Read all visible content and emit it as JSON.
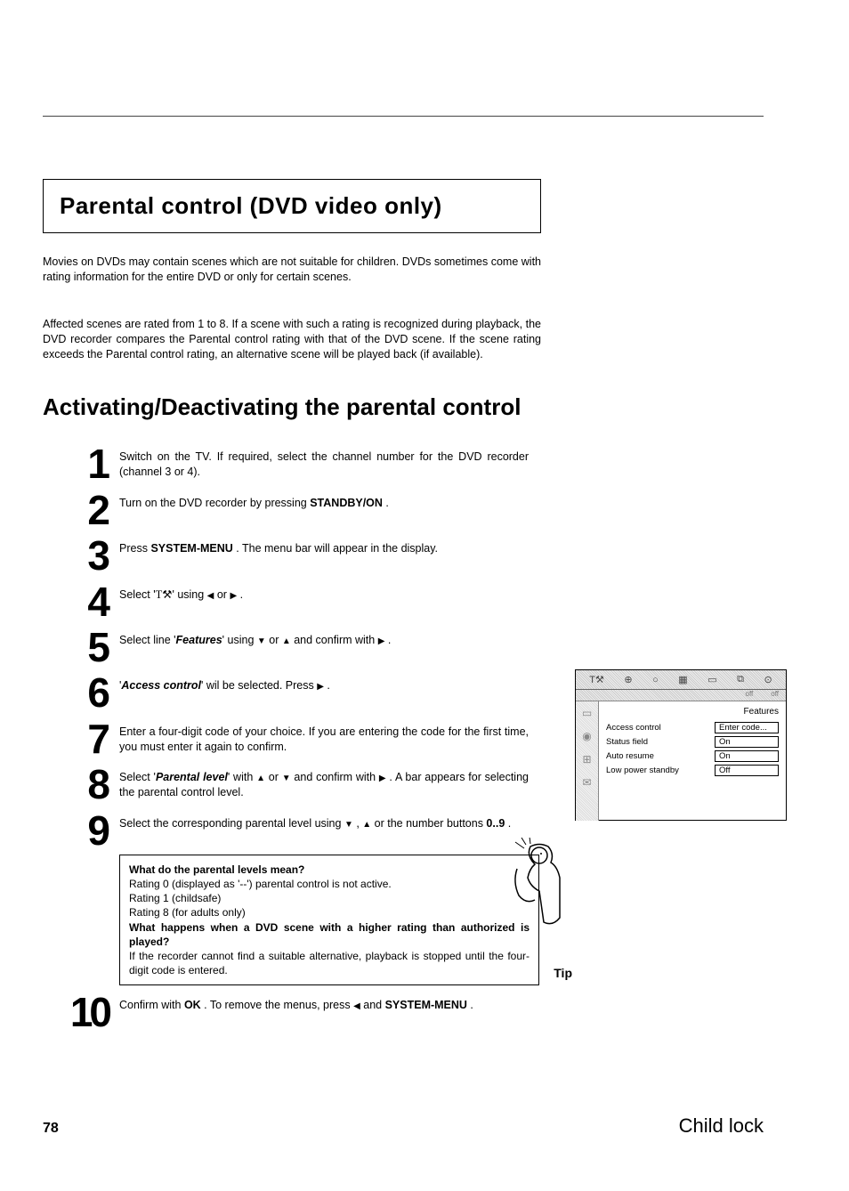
{
  "divider": true,
  "title": "Parental control (DVD video only)",
  "intro_p1": "Movies on DVDs may contain scenes which are not suitable for children. DVDs sometimes come with rating information for the entire DVD or only for certain scenes.",
  "intro_p2": "Affected scenes are rated from 1 to 8. If a scene with such a rating is recognized during playback, the DVD recorder compares the Parental control rating with that of the DVD scene. If the scene rating exceeds the Parental control rating, an alternative scene will be played back (if available).",
  "subheading": "Activating/Deactivating the parental control",
  "steps": {
    "s1": {
      "num": "1",
      "text_a": "Switch on the TV. If required, select the channel number for the DVD recorder (channel 3 or 4)."
    },
    "s2": {
      "num": "2",
      "text_a": "Turn on the DVD recorder by pressing ",
      "btn": "STANDBY/ON",
      "text_b": " ."
    },
    "s3": {
      "num": "3",
      "text_a": "Press ",
      "btn": "SYSTEM-MENU",
      "text_b": " . The menu bar will appear in the display."
    },
    "s4": {
      "num": "4",
      "text_a": "Select '",
      "icon": "wrench",
      "text_b": "' using ",
      "key1": "◀",
      "text_c": " or ",
      "key2": "▶",
      "text_d": " ."
    },
    "s5": {
      "num": "5",
      "text_a": "Select line '",
      "em": "Features",
      "text_b": "' using ",
      "key1": "▼",
      "text_c": " or ",
      "key2": "▲",
      "text_d": " and confirm with ",
      "key3": "▶",
      "text_e": " ."
    },
    "s6": {
      "num": "6",
      "text_a": "'",
      "em": "Access control",
      "text_b": "' wil be selected. Press ",
      "key1": "▶",
      "text_c": " ."
    },
    "s7": {
      "num": "7",
      "text_a": "Enter a four-digit code of your choice. If you are entering the code for the first time, you must enter it again to confirm."
    },
    "s8": {
      "num": "8",
      "text_a": "Select '",
      "em": "Parental level",
      "text_b": "' with ",
      "key1": "▲",
      "text_c": " or ",
      "key2": "▼",
      "text_d": " and confirm with ",
      "key3": "▶",
      "text_e": " . A bar appears for selecting the parental control level."
    },
    "s9": {
      "num": "9",
      "text_a": "Select the corresponding parental level using ",
      "key1": "▼",
      "text_b": " , ",
      "key2": "▲",
      "text_c": " or the number buttons ",
      "btn": "0..9",
      "text_d": " ."
    },
    "s10": {
      "num": "10",
      "text_a": "Confirm with ",
      "btn1": "OK",
      "text_b": " . To remove the menus, press ",
      "key1": "◀",
      "text_c": " and ",
      "btn2": "SYSTEM-MENU",
      "text_d": " ."
    }
  },
  "tip": {
    "q1": "What do the parental levels mean?",
    "a1a": "Rating 0 (displayed as '--') parental control is not active.",
    "a1b": "Rating 1 (childsafe)",
    "a1c": "Rating 8 (for adults only)",
    "q2": "What happens when a DVD scene with a higher rating than authorized is played?",
    "a2": "If the recorder cannot find a suitable alternative, playback is stopped until the four-digit code is entered.",
    "label": "Tip"
  },
  "osd": {
    "title": "Features",
    "rows": {
      "r1": {
        "label": "Access control",
        "value": "Enter code..."
      },
      "r2": {
        "label": "Status field",
        "value": "On"
      },
      "r3": {
        "label": "Auto resume",
        "value": "On"
      },
      "r4": {
        "label": "Low power standby",
        "value": "Off"
      }
    }
  },
  "footer": {
    "page": "78",
    "section": "Child lock"
  }
}
